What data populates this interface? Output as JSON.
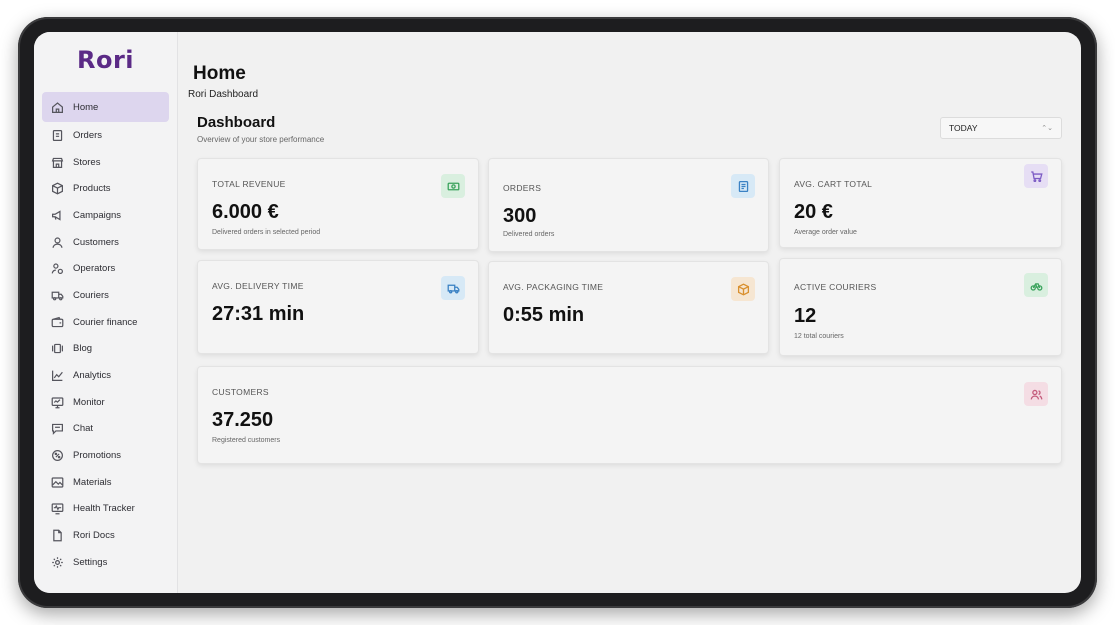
{
  "app": {
    "logo": "Rori"
  },
  "sidebar": {
    "items": [
      {
        "label": "Home",
        "icon": "home-icon",
        "active": true
      },
      {
        "label": "Orders",
        "icon": "orders-icon"
      },
      {
        "label": "Stores",
        "icon": "store-icon"
      },
      {
        "label": "Products",
        "icon": "box-icon"
      },
      {
        "label": "Campaigns",
        "icon": "megaphone-icon"
      },
      {
        "label": "Customers",
        "icon": "user-icon"
      },
      {
        "label": "Operators",
        "icon": "operator-icon"
      },
      {
        "label": "Couriers",
        "icon": "truck-icon"
      },
      {
        "label": "Courier finance",
        "icon": "wallet-icon"
      },
      {
        "label": "Blog",
        "icon": "blog-icon"
      },
      {
        "label": "Analytics",
        "icon": "analytics-icon"
      },
      {
        "label": "Monitor",
        "icon": "monitor-icon"
      },
      {
        "label": "Chat",
        "icon": "chat-icon"
      },
      {
        "label": "Promotions",
        "icon": "promotion-icon"
      },
      {
        "label": "Materials",
        "icon": "image-icon"
      },
      {
        "label": "Health Tracker",
        "icon": "health-icon"
      },
      {
        "label": "Rori Docs",
        "icon": "docs-icon"
      },
      {
        "label": "Settings",
        "icon": "gear-icon"
      }
    ]
  },
  "header": {
    "title": "Home",
    "breadcrumb": "Rori Dashboard"
  },
  "dashboard": {
    "title": "Dashboard",
    "subtitle": "Overview of your store performance",
    "period": "TODAY"
  },
  "cards": {
    "revenue": {
      "label": "TOTAL REVENUE",
      "value": "6.000 €",
      "sub": "Delivered orders in selected period",
      "icon": "money-icon",
      "color": "#3aa35c",
      "bg": "#d9efdf"
    },
    "orders": {
      "label": "ORDERS",
      "value": "300",
      "sub": "Delivered orders",
      "icon": "receipt-icon",
      "color": "#3b82c4",
      "bg": "#d7e9f6"
    },
    "cart": {
      "label": "AVG. CART TOTAL",
      "value": "20 €",
      "sub": "Average order value",
      "icon": "cart-icon",
      "color": "#7c5cc4",
      "bg": "#e6def4"
    },
    "delivery": {
      "label": "AVG. DELIVERY TIME",
      "value": "27:31 min",
      "sub": "",
      "icon": "truck-icon",
      "color": "#3b82c4",
      "bg": "#d7e9f6"
    },
    "packaging": {
      "label": "AVG. PACKAGING TIME",
      "value": "0:55 min",
      "sub": "",
      "icon": "package-icon",
      "color": "#d9902f",
      "bg": "#f6e6d2"
    },
    "couriers": {
      "label": "ACTIVE COURIERS",
      "value": "12",
      "sub": "12 total couriers",
      "icon": "bike-icon",
      "color": "#3aa35c",
      "bg": "#d9efdf"
    },
    "customers": {
      "label": "CUSTOMERS",
      "value": "37.250",
      "sub": "Registered customers",
      "icon": "users-icon",
      "color": "#c45c7c",
      "bg": "#f4dde4"
    }
  }
}
